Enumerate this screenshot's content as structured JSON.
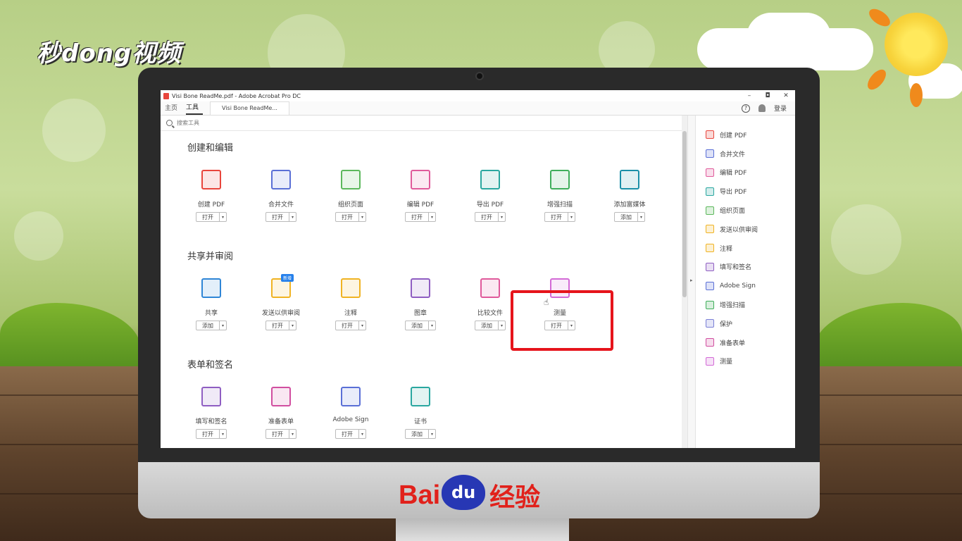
{
  "overlay": {
    "watermark_logo": "秒dong视频",
    "baidu_brand": "Bai",
    "baidu_paw_text": "du",
    "baidu_suffix": "经验"
  },
  "window": {
    "title": "Visi Bone ReadMe.pdf - Adobe Acrobat Pro DC",
    "minimize": "–",
    "restore": "◘",
    "close": "✕"
  },
  "tabs": {
    "home": "主页",
    "tools": "工具",
    "document": "Visi Bone ReadMe...",
    "help": "?",
    "login": "登录"
  },
  "search": {
    "placeholder": "搜索工具"
  },
  "sections": [
    {
      "title": "创建和编辑",
      "tools": [
        {
          "label": "创建 PDF",
          "button": "打开",
          "color": "#e8453c"
        },
        {
          "label": "合并文件",
          "button": "打开",
          "color": "#5a6fd6"
        },
        {
          "label": "组织页面",
          "button": "打开",
          "color": "#5cb85c"
        },
        {
          "label": "编辑 PDF",
          "button": "打开",
          "color": "#e05a9b"
        },
        {
          "label": "导出 PDF",
          "button": "打开",
          "color": "#2aa7a0"
        },
        {
          "label": "增强扫描",
          "button": "打开",
          "color": "#3fae5a"
        },
        {
          "label": "添加富媒体",
          "button": "添加",
          "color": "#1b8fa8"
        }
      ]
    },
    {
      "title": "共享并审阅",
      "tools": [
        {
          "label": "共享",
          "button": "添加",
          "color": "#2f86d6"
        },
        {
          "label": "发送以供审阅",
          "button": "打开",
          "color": "#f0b323",
          "badge": "新增"
        },
        {
          "label": "注释",
          "button": "打开",
          "color": "#f0b323"
        },
        {
          "label": "图章",
          "button": "添加",
          "color": "#8f5ec2"
        },
        {
          "label": "比较文件",
          "button": "添加",
          "color": "#e05a9b"
        },
        {
          "label": "测量",
          "button": "打开",
          "color": "#d36ad6"
        }
      ]
    },
    {
      "title": "表单和签名",
      "tools": [
        {
          "label": "填写和签名",
          "button": "打开",
          "color": "#8f5ec2"
        },
        {
          "label": "准备表单",
          "button": "打开",
          "color": "#d14ea0"
        },
        {
          "label": "Adobe Sign",
          "button": "打开",
          "color": "#5a6fd6"
        },
        {
          "label": "证书",
          "button": "添加",
          "color": "#2aa7a0"
        }
      ]
    }
  ],
  "right_panel": [
    {
      "label": "创建 PDF",
      "color": "#e8453c"
    },
    {
      "label": "合并文件",
      "color": "#5a6fd6"
    },
    {
      "label": "编辑 PDF",
      "color": "#e05a9b"
    },
    {
      "label": "导出 PDF",
      "color": "#2aa7a0"
    },
    {
      "label": "组织页面",
      "color": "#5cb85c"
    },
    {
      "label": "发送以供审阅",
      "color": "#f0b323"
    },
    {
      "label": "注释",
      "color": "#f0b323"
    },
    {
      "label": "填写和签名",
      "color": "#8f5ec2"
    },
    {
      "label": "Adobe Sign",
      "color": "#5a6fd6"
    },
    {
      "label": "增强扫描",
      "color": "#3fae5a"
    },
    {
      "label": "保护",
      "color": "#7a7fd6"
    },
    {
      "label": "准备表单",
      "color": "#d14ea0"
    },
    {
      "label": "测量",
      "color": "#d36ad6"
    }
  ],
  "dropdown_glyph": "▾",
  "expand_glyph": "▸"
}
